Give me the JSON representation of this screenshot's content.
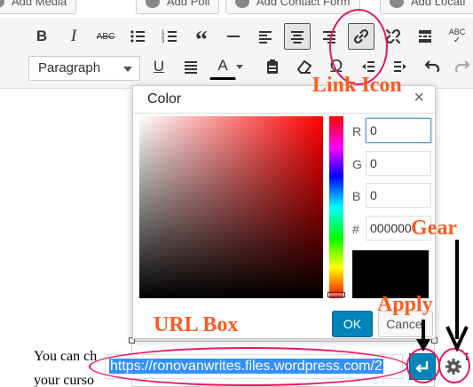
{
  "media_buttons": [
    {
      "label": "Add Media",
      "icon": "media-icon"
    },
    {
      "label": "Add Poll",
      "icon": "poll-icon"
    },
    {
      "label": "Add Contact Form",
      "icon": "form-icon"
    },
    {
      "label": "Add Locati",
      "icon": "location-icon"
    }
  ],
  "toolbar": {
    "format_select": "Paragraph",
    "row1": [
      "bold",
      "italic",
      "strikethrough",
      "bulleted-list",
      "numbered-list",
      "blockquote",
      "horizontal-line",
      "align-left",
      "align-center",
      "align-right",
      "insert-link",
      "remove-link",
      "insert-read-more",
      "spellcheck"
    ],
    "row2": [
      "underline",
      "justify",
      "text-color",
      "paste-as-text",
      "clear-formatting",
      "special-character",
      "outdent",
      "indent",
      "undo",
      "redo"
    ],
    "labels": {
      "bold": "B",
      "italic": "I",
      "strikethrough": "ABC",
      "spellcheck": "ABC",
      "underline": "U",
      "text_color": "A",
      "special_character": "Ω"
    }
  },
  "color_picker": {
    "title": "Color",
    "close": "×",
    "fields": [
      {
        "label": "R",
        "value": "0"
      },
      {
        "label": "G",
        "value": "0"
      },
      {
        "label": "B",
        "value": "0"
      },
      {
        "label": "#",
        "value": "000000"
      }
    ],
    "preview_color": "#000000",
    "ok_label": "OK",
    "cancel_label": "Cancel"
  },
  "editor": {
    "line1": "You can ch",
    "line1_end": "t",
    "line2": "your curso"
  },
  "link_toolbar": {
    "url": "https://ronovanwrites.files.wordpress.com/2"
  },
  "annotations": {
    "link_icon": "Link Icon",
    "gear": "Gear",
    "apply": "Apply",
    "url_box": "URL Box"
  },
  "colors": {
    "annotation_text": "#ff5a1f",
    "annotation_ring": "#e8175d",
    "primary_button": "#0085ba",
    "selection": "#3390ff"
  }
}
